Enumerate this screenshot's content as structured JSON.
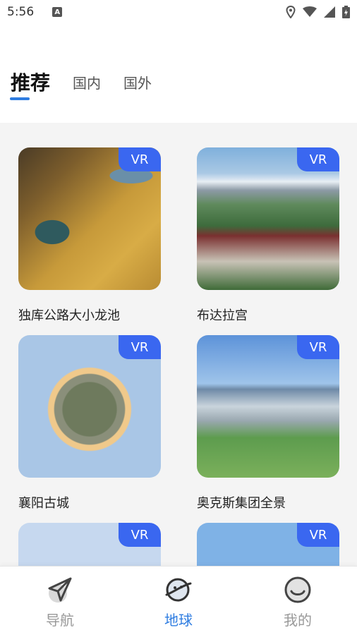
{
  "status_bar": {
    "time": "5:56",
    "a_badge": "A"
  },
  "tabs": [
    {
      "label": "推荐",
      "active": true
    },
    {
      "label": "国内",
      "active": false
    },
    {
      "label": "国外",
      "active": false
    }
  ],
  "cards": [
    {
      "title": "独库公路大小龙池",
      "badge": "VR"
    },
    {
      "title": "布达拉宫",
      "badge": "VR"
    },
    {
      "title": "襄阳古城",
      "badge": "VR"
    },
    {
      "title": "奥克斯集团全景",
      "badge": "VR"
    },
    {
      "title": "",
      "badge": "VR"
    },
    {
      "title": "",
      "badge": "VR"
    }
  ],
  "bottom_nav": [
    {
      "label": "导航",
      "icon": "paper-plane-icon",
      "active": false
    },
    {
      "label": "地球",
      "icon": "planet-icon",
      "active": true
    },
    {
      "label": "我的",
      "icon": "smiley-face-icon",
      "active": false
    }
  ],
  "colors": {
    "accent": "#2f7de1",
    "vr_badge": "#3a67f0",
    "content_bg": "#f4f4f4"
  }
}
